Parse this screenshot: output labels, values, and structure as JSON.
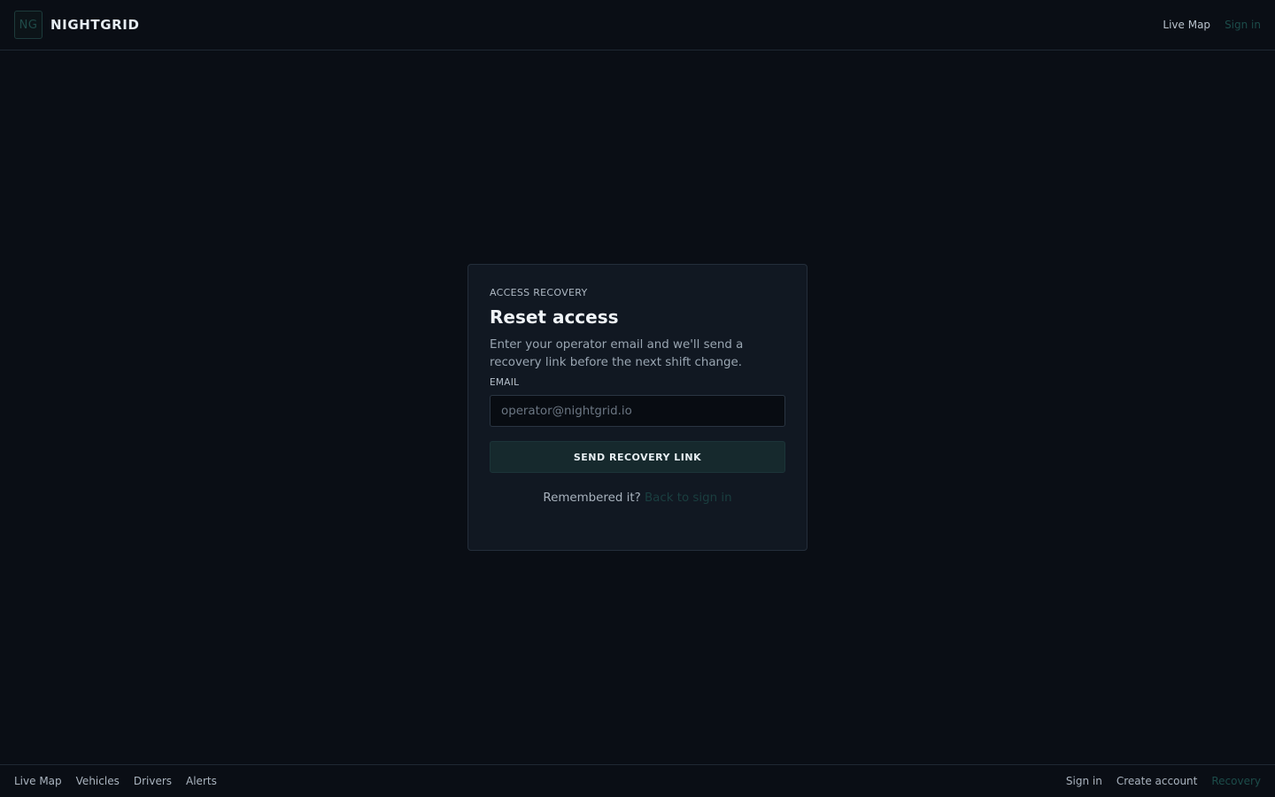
{
  "brand": {
    "logo": "NG",
    "name": "NIGHTGRID"
  },
  "top_nav": {
    "live_map": "Live Map",
    "sign_in": "Sign in"
  },
  "card": {
    "eyebrow": "ACCESS RECOVERY",
    "title": "Reset access",
    "description": "Enter your operator email and we'll send a recovery link before the next shift change.",
    "email_label": "EMAIL",
    "email_placeholder": "operator@nightgrid.io",
    "email_value": "",
    "submit_label": "SEND RECOVERY LINK",
    "remember_text": "Remembered it?",
    "back_link": "Back to sign in"
  },
  "footer": {
    "left": [
      "Live Map",
      "Vehicles",
      "Drivers",
      "Alerts"
    ],
    "right": [
      "Sign in",
      "Create account",
      "Recovery"
    ]
  },
  "colors": {
    "background": "#0a0e15",
    "card": "#111822",
    "accent_muted": "#1c4c4a",
    "button": "#16292d"
  }
}
